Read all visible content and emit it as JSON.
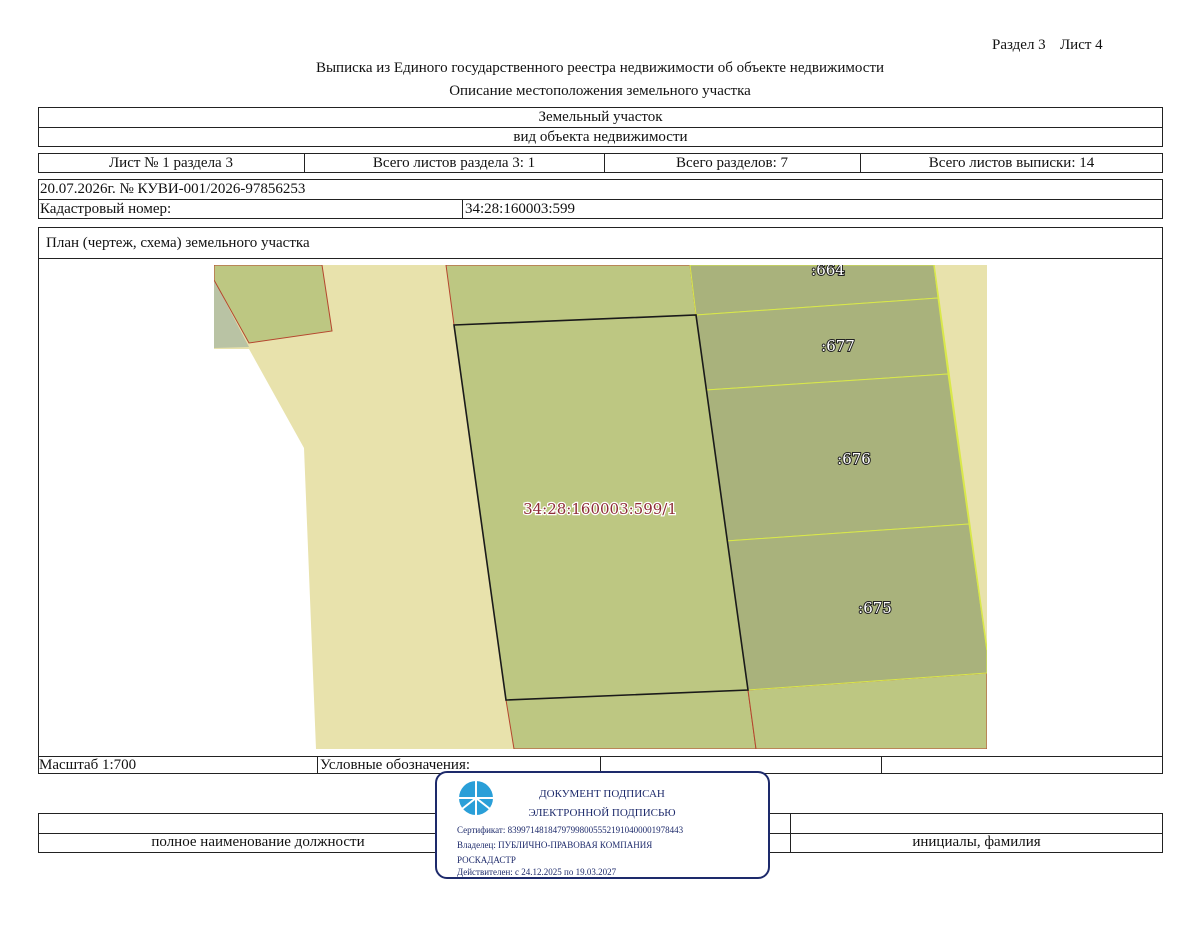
{
  "header": {
    "section_label": "Раздел 3",
    "sheet_label": "Лист 4",
    "title": "Выписка из Единого государственного реестра недвижимости об объекте недвижимости",
    "subtitle": "Описание местоположения земельного участка"
  },
  "object": {
    "type_value": "Земельный участок",
    "type_caption": "вид объекта недвижимости"
  },
  "sheets": {
    "sheet_no": "Лист № 1 раздела 3",
    "section_sheets_total": "Всего листов раздела 3: 1",
    "sections_total": "Всего разделов: 7",
    "extract_sheets_total": "Всего листов выписки: 14"
  },
  "record": {
    "date_number": "20.07.2026г. № КУВИ-001/2026-97856253",
    "cadastral_label": "Кадастровый номер:",
    "cadastral_number": "34:28:160003:599"
  },
  "plan": {
    "title": "План (чертеж, схема) земельного участка",
    "parcel_label": "34:28:160003:599/1",
    "neighbor_labels": [
      ":664",
      ":677",
      ":676",
      ":675"
    ],
    "colors": {
      "background_land": "#e8e2ac",
      "parcel_fill": "#bdc782",
      "neighbor_fill": "#a9b27c",
      "top_left_plot": "#bdc782",
      "gray_patch": "#b9c3a4",
      "parcel_label_color": "#8e2b36",
      "boundary_red": "#b5462e",
      "boundary_yellow": "#d9e84a"
    }
  },
  "legend": {
    "scale": "Масштаб 1:700",
    "legend_label": "Условные обозначения:"
  },
  "signature": {
    "position_caption": "полное наименование должности",
    "name_caption": "инициалы, фамилия"
  },
  "stamp": {
    "line1": "ДОКУМЕНТ ПОДПИСАН",
    "line2": "ЭЛЕКТРОННОЙ ПОДПИСЬЮ",
    "certificate": "Сертификат: 839971481847979980055521910400001978443",
    "owner_line1": "Владелец: ПУБЛИЧНО-ПРАВОВАЯ КОМПАНИЯ",
    "owner_line2": "РОСКАДАСТР",
    "validity": "Действителен: с 24.12.2025 по 19.03.2027",
    "color": "#1d2a6b",
    "logo_color": "#2a9fd8"
  }
}
